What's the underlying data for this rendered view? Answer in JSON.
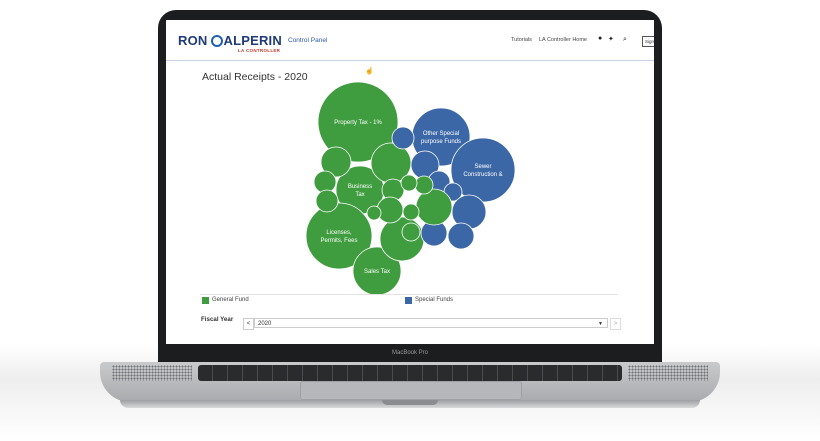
{
  "device": {
    "label": "MacBook Pro"
  },
  "header": {
    "logo_first": "RON",
    "logo_last": "ALPERIN",
    "logo_sub": "LA CONTROLLER",
    "control_panel": "Control Panel",
    "nav": [
      "Tutorials",
      "LA Controller Home"
    ],
    "icons": [
      "facebook-icon",
      "twitter-icon",
      "search-icon"
    ],
    "signin": "Sign In"
  },
  "page": {
    "title": "Actual Receipts - 2020"
  },
  "colors": {
    "general_fund": "#3f9c3f",
    "special_funds": "#3b67a6"
  },
  "chart_data": {
    "type": "bubble",
    "title": "Actual Receipts - 2020",
    "legend": [
      "General Fund",
      "Special Funds"
    ],
    "labeled_bubbles": [
      {
        "label": "Property Tax - 1%",
        "group": "General Fund"
      },
      {
        "label": "Other Special purpose Funds",
        "group": "Special Funds"
      },
      {
        "label": "Sewer Construction &",
        "group": "Special Funds"
      },
      {
        "label": "Business Tax",
        "group": "General Fund"
      },
      {
        "label": "Licenses, Permits, Fees",
        "group": "General Fund"
      },
      {
        "label": "Sales Tax",
        "group": "General Fund"
      }
    ]
  },
  "legend": {
    "general": "General Fund",
    "special": "Special Funds"
  },
  "filter": {
    "label": "Fiscal Year",
    "prev": "<",
    "value": "2020",
    "next": ">"
  }
}
